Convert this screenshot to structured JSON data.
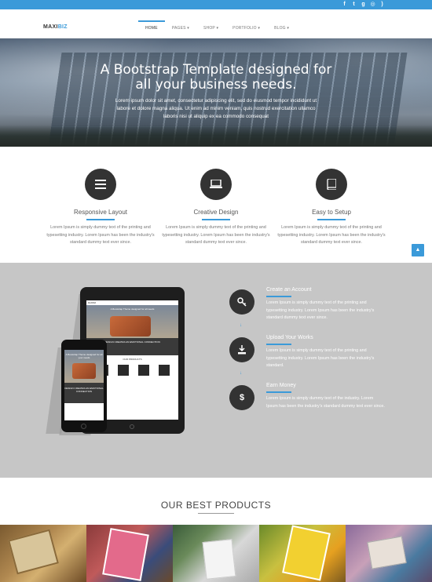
{
  "brand": {
    "logo_main": "MAXI",
    "logo_accent": "BIZ",
    "accent_color": "#3b9ad9"
  },
  "social_icons": [
    "facebook-icon",
    "twitter-icon",
    "google-plus-icon",
    "dribbble-icon",
    "rss-icon"
  ],
  "nav": [
    {
      "label": "HOME",
      "active": true
    },
    {
      "label": "PAGES ▾",
      "active": false
    },
    {
      "label": "SHOP ▾",
      "active": false
    },
    {
      "label": "PORTFOLIO ▾",
      "active": false
    },
    {
      "label": "BLOG ▾",
      "active": false
    }
  ],
  "hero": {
    "title_line1": "A Bootstrap Template designed for",
    "title_line2": "all your business needs.",
    "text": "Lorem ipsum dolor sit amet, consectetur adipiscing elit, sed do eiusmod tempor incididunt ut labore et dolore magna aliqua. Ut enim ad minim veniam, quis nostrud exercitation ullamco laboris nisi ut aliquip ex ea commodo consequat"
  },
  "features": [
    {
      "icon": "menu-icon",
      "title": "Responsive Layout",
      "text": "Lorem Ipsum is simply dummy text of the printing and typesetting industry. Lorem Ipsum has been the industry's standard dummy text ever since."
    },
    {
      "icon": "laptop-icon",
      "title": "Creative Design",
      "text": "Lorem Ipsum is simply dummy text of the printing and typesetting industry. Lorem Ipsum has been the industry's standard dummy text ever since."
    },
    {
      "icon": "book-icon",
      "title": "Easy to Setup",
      "text": "Lorem Ipsum is simply dummy text of the printing and typesetting industry. Lorem Ipsum has been the industry's standard dummy text ever since."
    }
  ],
  "to_top": "▲",
  "mockup": {
    "tablet_title": "A Bootstrap Theme designed for all needs",
    "tablet_dark": "DESIGN CREATES AN EMOTIONAL CONNECTION",
    "tablet_products": "OUR PRODUCTS",
    "phone_title": "A Bootstrap Theme designed for all your needs",
    "phone_dark": "DESIGN CREATES AN EMOTIONAL CONNECTION"
  },
  "steps": [
    {
      "icon": "key-icon",
      "title": "Create an Account",
      "text": "Lorem Ipsum is simply dummy text of the printing and typesetting industry. Lorem Ipsum has been the industry's standard dummy text ever since."
    },
    {
      "icon": "download-icon",
      "title": "Upload Your Works",
      "text": "Lorem Ipsum is simply dummy text of the printing and typesetting industry. Lorem Ipsum has been the industry's standard."
    },
    {
      "icon": "dollar-icon",
      "title": "Earn Money",
      "text": "Lorem Ipsum is simply dummy text of the industry. Lorem Ipsum has been the industry's standard dummy text ever since."
    }
  ],
  "step_arrow": "↓",
  "products": {
    "title": "OUR BEST PRODUCTS"
  }
}
